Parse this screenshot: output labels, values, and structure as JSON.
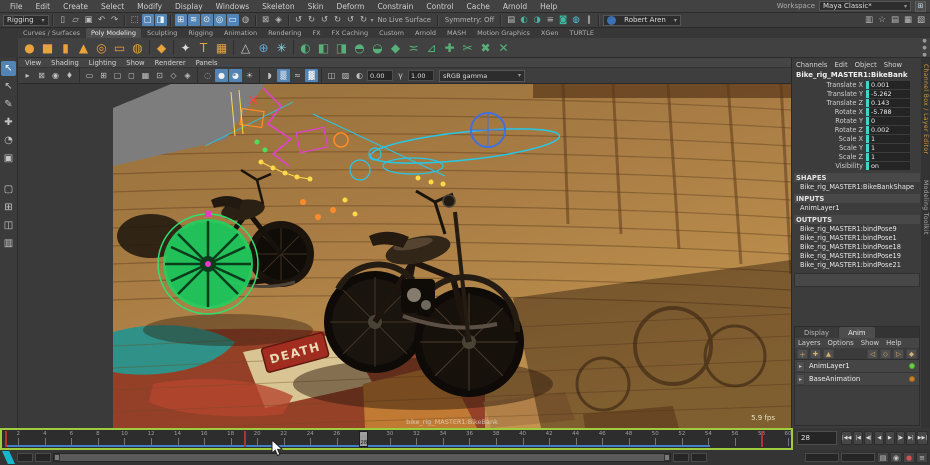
{
  "app": {
    "workspace_label": "Workspace",
    "workspace_value": "Maya Classic*"
  },
  "menu_bar": {
    "items": [
      "File",
      "Edit",
      "Create",
      "Select",
      "Modify",
      "Display",
      "Windows",
      "Skeleton",
      "Skin",
      "Deform",
      "Constrain",
      "Control",
      "Cache",
      "Arnold",
      "Help"
    ]
  },
  "status_line": {
    "menu_set": "Rigging",
    "file_icons": [
      {
        "name": "new-scene-icon",
        "g": "▯"
      },
      {
        "name": "open-scene-icon",
        "g": "▱"
      },
      {
        "name": "save-scene-icon",
        "g": "▣"
      },
      {
        "name": "undo-icon",
        "g": "↶"
      },
      {
        "name": "redo-icon",
        "g": "↷"
      }
    ],
    "select_mode_icons": [
      {
        "name": "select-hierarchy-icon",
        "g": "⬚"
      },
      {
        "name": "select-object-icon",
        "g": "▢",
        "on": true
      },
      {
        "name": "select-component-icon",
        "g": "◨",
        "on": true
      }
    ],
    "snap_icons": [
      {
        "name": "snap-to-grid-icon",
        "g": "⊞",
        "on": true
      },
      {
        "name": "snap-to-curves-icon",
        "g": "≋",
        "on": true
      },
      {
        "name": "snap-to-points-icon",
        "g": "⊙",
        "on": true
      },
      {
        "name": "snap-to-projected-center-icon",
        "g": "◎",
        "on": true
      },
      {
        "name": "snap-to-view-plane-icon",
        "g": "▭",
        "on": true
      },
      {
        "name": "make-live-icon",
        "g": "◍"
      }
    ],
    "lock_icons": [
      {
        "name": "lock-selection-icon",
        "g": "⊠"
      },
      {
        "name": "highlight-affected-icon",
        "g": "◈"
      }
    ],
    "history_icons": [
      {
        "name": "inputs-to-selected-icon",
        "g": "↺"
      },
      {
        "name": "outputs-from-selected-icon",
        "g": "↻"
      },
      {
        "name": "construction-history-icon",
        "g": "↺"
      },
      {
        "name": "history-toggle-icon",
        "g": "↻"
      },
      {
        "name": "evaluation-icon",
        "g": "↺"
      },
      {
        "name": "cycle-check-icon",
        "g": "↻"
      }
    ],
    "no_live_surface": "No Live Surface",
    "symmetry": "Symmetry: Off",
    "render_icons": [
      {
        "name": "render-view-icon",
        "g": "▤",
        "c": "#c0c0c0"
      },
      {
        "name": "render-current-frame-icon",
        "g": "◐",
        "c": "#3fb8a0"
      },
      {
        "name": "ipr-render-icon",
        "g": "◑",
        "c": "#3fb8a0"
      },
      {
        "name": "render-settings-icon",
        "g": "≡",
        "c": "#c0c0c0"
      },
      {
        "name": "hypershade-icon",
        "g": "◙",
        "c": "#3fb8a0"
      },
      {
        "name": "light-editor-icon",
        "g": "◍",
        "c": "#58c8e8"
      },
      {
        "name": "pause-viewport-icon",
        "g": "∥",
        "c": "#c0c0c0"
      }
    ],
    "user": {
      "name": "Robert Aren",
      "avatar_color": "#3d6fb4"
    },
    "right_icons": [
      {
        "name": "modeling-toolkit-toggle-icon",
        "g": "▥"
      },
      {
        "name": "humanik-toggle-icon",
        "g": "☆"
      },
      {
        "name": "attribute-editor-toggle-icon",
        "g": "▤"
      },
      {
        "name": "tool-settings-toggle-icon",
        "g": "▦"
      },
      {
        "name": "channel-box-toggle-icon",
        "g": "▧"
      }
    ],
    "workspace_grid_icon": {
      "name": "workspace-grid-icon",
      "g": "⊞"
    }
  },
  "shelf": {
    "active_tab": "Poly Modeling",
    "tabs": [
      "Curves / Surfaces",
      "Poly Modeling",
      "Sculpting",
      "Rigging",
      "Animation",
      "Rendering",
      "FX",
      "FX Caching",
      "Custom",
      "Arnold",
      "MASH",
      "Motion Graphics",
      "XGen",
      "TURTLE"
    ],
    "icons": [
      {
        "name": "poly-sphere-icon",
        "g": "●",
        "c": "#e8a33d"
      },
      {
        "name": "poly-cube-icon",
        "g": "■",
        "c": "#e8a33d"
      },
      {
        "name": "poly-cylinder-icon",
        "g": "▮",
        "c": "#e8a33d"
      },
      {
        "name": "poly-cone-icon",
        "g": "▲",
        "c": "#e8a33d"
      },
      {
        "name": "poly-torus-icon",
        "g": "◎",
        "c": "#e8a33d"
      },
      {
        "name": "poly-plane-icon",
        "g": "▭",
        "c": "#e8a33d"
      },
      {
        "name": "poly-disc-icon",
        "g": "◍",
        "c": "#e8a33d"
      },
      {
        "name": "sep",
        "sep": true
      },
      {
        "name": "platonic-solid-icon",
        "g": "◆",
        "c": "#e8a33d"
      },
      {
        "name": "sep",
        "sep": true
      },
      {
        "name": "sculpt-tool-icon",
        "g": "✦",
        "c": "#d8d8d8"
      },
      {
        "name": "poly-text-icon",
        "g": "T",
        "c": "#e8a33d"
      },
      {
        "name": "svg-import-icon",
        "g": "▦",
        "c": "#e8a33d"
      },
      {
        "name": "sep",
        "sep": true
      },
      {
        "name": "quad-draw-icon",
        "g": "△",
        "c": "#c8c8c8"
      },
      {
        "name": "target-weld-icon",
        "g": "⊕",
        "c": "#58a8d8"
      },
      {
        "name": "remesh-icon",
        "g": "✳",
        "c": "#8fd8e8"
      },
      {
        "name": "sep",
        "sep": true
      },
      {
        "name": "mirror-icon",
        "g": "◐",
        "c": "#57b07a"
      },
      {
        "name": "combine-icon",
        "g": "◧",
        "c": "#57b07a"
      },
      {
        "name": "separate-icon",
        "g": "◨",
        "c": "#57b07a"
      },
      {
        "name": "boolean-icon",
        "g": "◓",
        "c": "#57b07a"
      },
      {
        "name": "smooth-icon",
        "g": "◒",
        "c": "#57b07a"
      },
      {
        "name": "bevel-icon",
        "g": "◆",
        "c": "#57b07a"
      },
      {
        "name": "bridge-icon",
        "g": "≍",
        "c": "#57b07a"
      },
      {
        "name": "extrude-icon",
        "g": "⊿",
        "c": "#57b07a"
      },
      {
        "name": "crease-icon",
        "g": "✚",
        "c": "#57b07a"
      },
      {
        "name": "multi-cut-icon",
        "g": "✂",
        "c": "#57b07a"
      },
      {
        "name": "delete-edge-icon",
        "g": "✖",
        "c": "#57b07a"
      },
      {
        "name": "delete-vertex-icon",
        "g": "✕",
        "c": "#57b07a"
      }
    ]
  },
  "toolbox": {
    "tools": [
      {
        "name": "select-tool",
        "g": "↖",
        "on": true
      },
      {
        "name": "lasso-select-tool",
        "g": "↖"
      },
      {
        "name": "paint-select-tool",
        "g": "✎"
      },
      {
        "name": "move-tool",
        "g": "✚"
      },
      {
        "name": "rotate-tool",
        "g": "◔"
      },
      {
        "name": "scale-tool",
        "g": "▣"
      }
    ],
    "layouts": [
      {
        "name": "layout-single-pane",
        "g": "▢"
      },
      {
        "name": "layout-four-pane",
        "g": "⊞"
      },
      {
        "name": "layout-two-pane",
        "g": "◫"
      },
      {
        "name": "layout-outliner-persp",
        "g": "▥"
      }
    ]
  },
  "panel": {
    "menus": [
      "View",
      "Shading",
      "Lighting",
      "Show",
      "Renderer",
      "Panels"
    ],
    "toolbar_icons": [
      {
        "name": "select-camera-icon",
        "g": "▸"
      },
      {
        "name": "lock-camera-icon",
        "g": "⊠"
      },
      {
        "name": "camera-attributes-icon",
        "g": "◉"
      },
      {
        "name": "bookmark-icon",
        "g": "♦"
      },
      {
        "name": "sep",
        "sep": true
      },
      {
        "name": "image-plane-icon",
        "g": "▭"
      },
      {
        "name": "grid-display-icon",
        "g": "⊞"
      },
      {
        "name": "film-gate-icon",
        "g": "▢"
      },
      {
        "name": "resolution-gate-icon",
        "g": "◻"
      },
      {
        "name": "gate-mask-icon",
        "g": "▦"
      },
      {
        "name": "field-chart-icon",
        "g": "⊡"
      },
      {
        "name": "safe-action-icon",
        "g": "◇"
      },
      {
        "name": "safe-title-icon",
        "g": "◈"
      },
      {
        "name": "sep",
        "sep": true
      },
      {
        "name": "wireframe-icon",
        "g": "◌"
      },
      {
        "name": "shaded-icon",
        "g": "●",
        "on": true
      },
      {
        "name": "textured-icon",
        "g": "◕",
        "on": true
      },
      {
        "name": "lights-icon",
        "g": "☀"
      },
      {
        "name": "sep",
        "sep": true
      },
      {
        "name": "shadows-icon",
        "g": "◗"
      },
      {
        "name": "screen-space-ao-icon",
        "g": "▒",
        "on": true
      },
      {
        "name": "motion-blur-icon",
        "g": "≈"
      },
      {
        "name": "multisample-icon",
        "g": "▓",
        "on": true
      },
      {
        "name": "sep",
        "sep": true
      },
      {
        "name": "isolate-select-icon",
        "g": "◫"
      },
      {
        "name": "xray-icon",
        "g": "▨"
      },
      {
        "name": "exposure-icon",
        "g": "◐"
      }
    ],
    "exposure_value": "0.00",
    "gamma_icon": {
      "name": "gamma-icon",
      "g": "γ"
    },
    "gamma_value": "1.00",
    "view_transform": "sRGB gamma",
    "fps": "5.9 fps",
    "camera_label": "bike_rig_MASTER1:BikeBank"
  },
  "scene": {
    "floor_sign_text": "DEATH"
  },
  "channel_box": {
    "menus": [
      "Channels",
      "Edit",
      "Object",
      "Show"
    ],
    "object_name": "Bike_rig_MASTER1:BikeBank",
    "channels": [
      {
        "label": "Translate X",
        "value": "0.001"
      },
      {
        "label": "Translate Y",
        "value": "-5.262"
      },
      {
        "label": "Translate Z",
        "value": "0.143"
      },
      {
        "label": "Rotate X",
        "value": "-5.788"
      },
      {
        "label": "Rotate Y",
        "value": "0"
      },
      {
        "label": "Rotate Z",
        "value": "0.002"
      },
      {
        "label": "Scale X",
        "value": "1"
      },
      {
        "label": "Scale Y",
        "value": "1"
      },
      {
        "label": "Scale Z",
        "value": "1"
      },
      {
        "label": "Visibility",
        "value": "on"
      }
    ],
    "shapes_header": "SHAPES",
    "shape_node": "Bike_rig_MASTER1:BikeBankShape",
    "inputs_header": "INPUTS",
    "input_node": "AnimLayer1",
    "outputs_header": "OUTPUTS",
    "outputs": [
      "Bike_rig_MASTER1:bindPose9",
      "Bike_rig_MASTER1:bindPose1",
      "Bike_rig_MASTER1:bindPose18",
      "Bike_rig_MASTER1:bindPose19",
      "Bike_rig_MASTER1:bindPose21"
    ]
  },
  "side_tabs": [
    {
      "label": "Channel Box / Layer Editor",
      "c": "#d89a3c"
    },
    {
      "label": "Modeling Toolkit",
      "c": "#b0b0b0"
    }
  ],
  "layer_editor": {
    "tabs": [
      "Display",
      "Anim"
    ],
    "active_tab": "Anim",
    "menus": [
      "Layers",
      "Options",
      "Show",
      "Help"
    ],
    "layers": [
      {
        "name": "AnimLayer1",
        "led": "#6fe04a",
        "cells": [
          "◌",
          "≡",
          "⊘"
        ],
        "arrow": "▸"
      },
      {
        "name": "BaseAnimation",
        "led": "#d98a2b",
        "cells": [
          "◌"
        ],
        "arrow": "▸"
      }
    ]
  },
  "timeline": {
    "start": 1,
    "end": 60,
    "label_step": 2,
    "current_frame": 28,
    "current_label": "28",
    "keyframes": [
      1,
      19,
      58
    ],
    "current_field_value": "28"
  },
  "playback": {
    "buttons": [
      {
        "name": "go-to-start-button",
        "g": "|◀◀"
      },
      {
        "name": "step-back-frame-button",
        "g": "|◀"
      },
      {
        "name": "step-back-key-button",
        "g": "◀|"
      },
      {
        "name": "play-backwards-button",
        "g": "◀"
      },
      {
        "name": "play-forwards-button",
        "g": "▶"
      },
      {
        "name": "step-forward-key-button",
        "g": "|▶"
      },
      {
        "name": "step-forward-frame-button",
        "g": "▶|"
      },
      {
        "name": "go-to-end-button",
        "g": "▶▶|"
      }
    ]
  },
  "range_slider": {
    "icons": [
      {
        "name": "anim-layer-indicator-icon",
        "g": "▤"
      },
      {
        "name": "character-set-icon",
        "g": "◉"
      },
      {
        "name": "auto-keyframe-icon",
        "g": "●",
        "auto": true
      },
      {
        "name": "animation-preferences-icon",
        "g": "≡"
      }
    ]
  },
  "colors": {
    "highlight_blue": "#5285b6",
    "timeline_focus_green": "#9fcb3f",
    "channel_slider_teal": "#3fd6c8",
    "keyframe_red": "#b03434",
    "shelf_orange": "#e8a33d"
  }
}
